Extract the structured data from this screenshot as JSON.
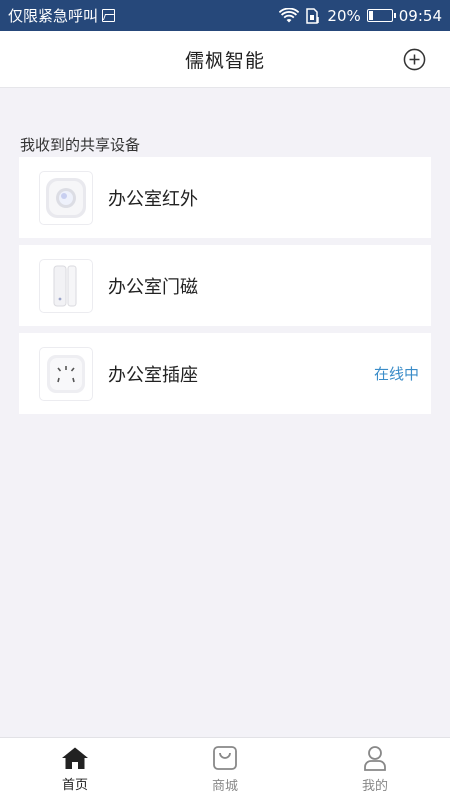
{
  "status_bar": {
    "carrier_text": "仅限紧急呼叫",
    "battery_percent": "20%",
    "time": "09:54",
    "battery_level": 0.2,
    "icons": [
      "image-icon",
      "wifi-icon",
      "sim-icon",
      "battery-icon"
    ]
  },
  "header": {
    "title": "儒枫智能",
    "add_icon": "plus-circle-icon"
  },
  "section": {
    "title": "我收到的共享设备"
  },
  "devices": [
    {
      "name": "办公室红外",
      "status": "",
      "icon": "infrared-sensor-icon"
    },
    {
      "name": "办公室门磁",
      "status": "",
      "icon": "door-sensor-icon"
    },
    {
      "name": "办公室插座",
      "status": "在线中",
      "icon": "smart-socket-icon"
    }
  ],
  "bottom_nav": {
    "items": [
      {
        "label": "首页",
        "icon": "home-icon",
        "active": true
      },
      {
        "label": "商城",
        "icon": "shopping-bag-icon",
        "active": false
      },
      {
        "label": "我的",
        "icon": "user-icon",
        "active": false
      }
    ]
  },
  "colors": {
    "status_bar_bg": "#26487a",
    "accent_status": "#3a8cc8",
    "page_bg": "#f3f2f7"
  }
}
